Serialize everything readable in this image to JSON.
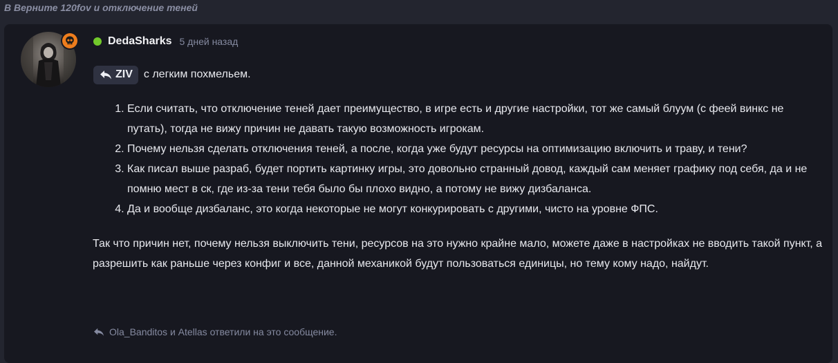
{
  "thread": {
    "title": "В Верните 120fov и отключение теней"
  },
  "post": {
    "author": "DedaSharks",
    "online": true,
    "time": "5 дней назад",
    "badge_icon": "skull-icon",
    "reply_to": {
      "name": "ZIV",
      "text": "с легким похмельем."
    },
    "list_items": [
      "Если считать, что отключение теней дает преимущество, в игре есть и другие настройки, тот же самый блуум (с феей винкс не путать), тогда не вижу причин не давать такую возможность игрокам.",
      "Почему нельзя сделать отключения теней, а после, когда уже будут ресурсы на оптимизацию включить и траву, и тени?",
      "Как писал выше разраб, будет портить картинку игры, это довольно странный довод, каждый сам меняет графику под себя, да и не помню мест в ск, где из-за тени тебя было бы плохо видно, а потому не вижу дизбаланса.",
      "Да и вообще дизбаланс, это когда некоторые не могут конкурировать с другими, чисто на уровне ФПС."
    ],
    "paragraph": "Так что причин нет, почему нельзя выключить тени, ресурсов на это нужно крайне мало, можете даже в настройках не вводить такой пункт, а разрешить как раньше через конфиг и все, данной механикой будут пользоваться единицы, но тему кому надо, найдут.",
    "replies_text": "Ola_Banditos и Atellas ответили на это сообщение."
  },
  "colors": {
    "page_bg": "#23252f",
    "card_bg": "#171820",
    "online": "#72c92b",
    "badge": "#ee7d1d",
    "muted": "#858aa0",
    "text": "#e8e9ee"
  }
}
